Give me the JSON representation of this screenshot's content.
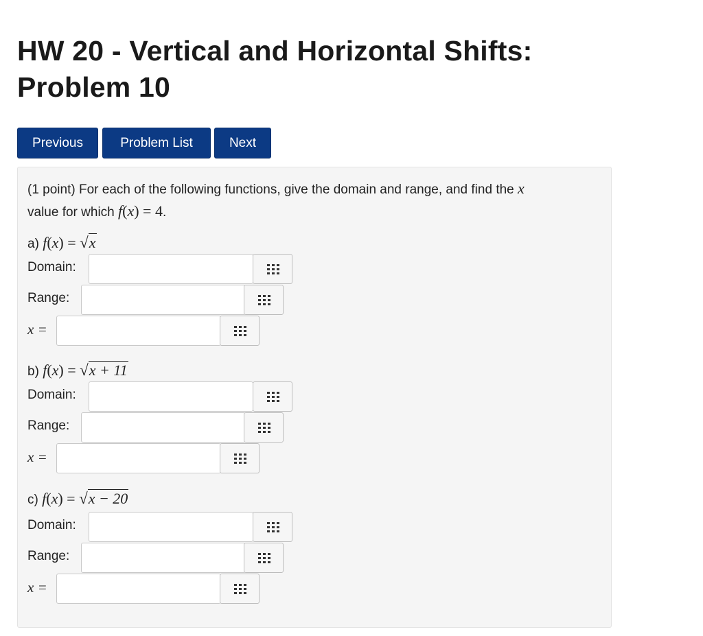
{
  "page": {
    "title": "HW 20 - Vertical and Horizontal Shifts: Problem 10"
  },
  "nav": {
    "previous": "Previous",
    "problem_list": "Problem List",
    "next": "Next"
  },
  "problem": {
    "points": "(1 point)",
    "intro_text": "For each of the following functions, give the domain and range, and find the",
    "intro_var": "x",
    "intro_text2": "value for which",
    "target_value": "4",
    "parts": [
      {
        "prefix": "a)",
        "radicand": "x",
        "domain_label": "Domain:",
        "range_label": "Range:",
        "x_label": "x =",
        "domain_value": "",
        "range_value": "",
        "x_value": ""
      },
      {
        "prefix": "b)",
        "radicand": "x + 11",
        "domain_label": "Domain:",
        "range_label": "Range:",
        "x_label": "x =",
        "domain_value": "",
        "range_value": "",
        "x_value": ""
      },
      {
        "prefix": "c)",
        "radicand": "x − 20",
        "domain_label": "Domain:",
        "range_label": "Range:",
        "x_label": "x =",
        "domain_value": "",
        "range_value": "",
        "x_value": ""
      }
    ]
  },
  "icons": {
    "matrix_button": "grid-icon"
  },
  "colors": {
    "button_bg": "#0c3a84",
    "panel_bg": "#f5f5f5"
  }
}
